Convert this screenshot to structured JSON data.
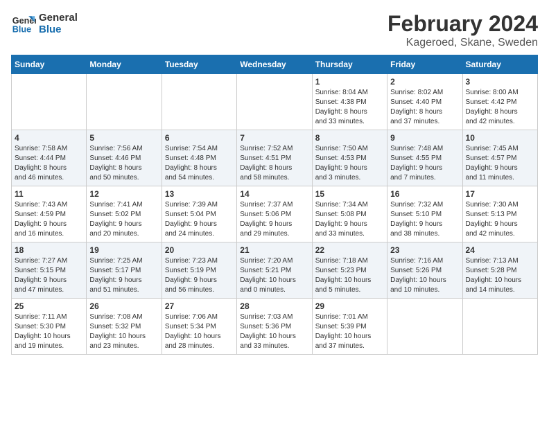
{
  "header": {
    "logo_line1": "General",
    "logo_line2": "Blue",
    "title": "February 2024",
    "subtitle": "Kageroed, Skane, Sweden"
  },
  "weekdays": [
    "Sunday",
    "Monday",
    "Tuesday",
    "Wednesday",
    "Thursday",
    "Friday",
    "Saturday"
  ],
  "weeks": [
    [
      {
        "day": "",
        "info": ""
      },
      {
        "day": "",
        "info": ""
      },
      {
        "day": "",
        "info": ""
      },
      {
        "day": "",
        "info": ""
      },
      {
        "day": "1",
        "info": "Sunrise: 8:04 AM\nSunset: 4:38 PM\nDaylight: 8 hours\nand 33 minutes."
      },
      {
        "day": "2",
        "info": "Sunrise: 8:02 AM\nSunset: 4:40 PM\nDaylight: 8 hours\nand 37 minutes."
      },
      {
        "day": "3",
        "info": "Sunrise: 8:00 AM\nSunset: 4:42 PM\nDaylight: 8 hours\nand 42 minutes."
      }
    ],
    [
      {
        "day": "4",
        "info": "Sunrise: 7:58 AM\nSunset: 4:44 PM\nDaylight: 8 hours\nand 46 minutes."
      },
      {
        "day": "5",
        "info": "Sunrise: 7:56 AM\nSunset: 4:46 PM\nDaylight: 8 hours\nand 50 minutes."
      },
      {
        "day": "6",
        "info": "Sunrise: 7:54 AM\nSunset: 4:48 PM\nDaylight: 8 hours\nand 54 minutes."
      },
      {
        "day": "7",
        "info": "Sunrise: 7:52 AM\nSunset: 4:51 PM\nDaylight: 8 hours\nand 58 minutes."
      },
      {
        "day": "8",
        "info": "Sunrise: 7:50 AM\nSunset: 4:53 PM\nDaylight: 9 hours\nand 3 minutes."
      },
      {
        "day": "9",
        "info": "Sunrise: 7:48 AM\nSunset: 4:55 PM\nDaylight: 9 hours\nand 7 minutes."
      },
      {
        "day": "10",
        "info": "Sunrise: 7:45 AM\nSunset: 4:57 PM\nDaylight: 9 hours\nand 11 minutes."
      }
    ],
    [
      {
        "day": "11",
        "info": "Sunrise: 7:43 AM\nSunset: 4:59 PM\nDaylight: 9 hours\nand 16 minutes."
      },
      {
        "day": "12",
        "info": "Sunrise: 7:41 AM\nSunset: 5:02 PM\nDaylight: 9 hours\nand 20 minutes."
      },
      {
        "day": "13",
        "info": "Sunrise: 7:39 AM\nSunset: 5:04 PM\nDaylight: 9 hours\nand 24 minutes."
      },
      {
        "day": "14",
        "info": "Sunrise: 7:37 AM\nSunset: 5:06 PM\nDaylight: 9 hours\nand 29 minutes."
      },
      {
        "day": "15",
        "info": "Sunrise: 7:34 AM\nSunset: 5:08 PM\nDaylight: 9 hours\nand 33 minutes."
      },
      {
        "day": "16",
        "info": "Sunrise: 7:32 AM\nSunset: 5:10 PM\nDaylight: 9 hours\nand 38 minutes."
      },
      {
        "day": "17",
        "info": "Sunrise: 7:30 AM\nSunset: 5:13 PM\nDaylight: 9 hours\nand 42 minutes."
      }
    ],
    [
      {
        "day": "18",
        "info": "Sunrise: 7:27 AM\nSunset: 5:15 PM\nDaylight: 9 hours\nand 47 minutes."
      },
      {
        "day": "19",
        "info": "Sunrise: 7:25 AM\nSunset: 5:17 PM\nDaylight: 9 hours\nand 51 minutes."
      },
      {
        "day": "20",
        "info": "Sunrise: 7:23 AM\nSunset: 5:19 PM\nDaylight: 9 hours\nand 56 minutes."
      },
      {
        "day": "21",
        "info": "Sunrise: 7:20 AM\nSunset: 5:21 PM\nDaylight: 10 hours\nand 0 minutes."
      },
      {
        "day": "22",
        "info": "Sunrise: 7:18 AM\nSunset: 5:23 PM\nDaylight: 10 hours\nand 5 minutes."
      },
      {
        "day": "23",
        "info": "Sunrise: 7:16 AM\nSunset: 5:26 PM\nDaylight: 10 hours\nand 10 minutes."
      },
      {
        "day": "24",
        "info": "Sunrise: 7:13 AM\nSunset: 5:28 PM\nDaylight: 10 hours\nand 14 minutes."
      }
    ],
    [
      {
        "day": "25",
        "info": "Sunrise: 7:11 AM\nSunset: 5:30 PM\nDaylight: 10 hours\nand 19 minutes."
      },
      {
        "day": "26",
        "info": "Sunrise: 7:08 AM\nSunset: 5:32 PM\nDaylight: 10 hours\nand 23 minutes."
      },
      {
        "day": "27",
        "info": "Sunrise: 7:06 AM\nSunset: 5:34 PM\nDaylight: 10 hours\nand 28 minutes."
      },
      {
        "day": "28",
        "info": "Sunrise: 7:03 AM\nSunset: 5:36 PM\nDaylight: 10 hours\nand 33 minutes."
      },
      {
        "day": "29",
        "info": "Sunrise: 7:01 AM\nSunset: 5:39 PM\nDaylight: 10 hours\nand 37 minutes."
      },
      {
        "day": "",
        "info": ""
      },
      {
        "day": "",
        "info": ""
      }
    ]
  ]
}
